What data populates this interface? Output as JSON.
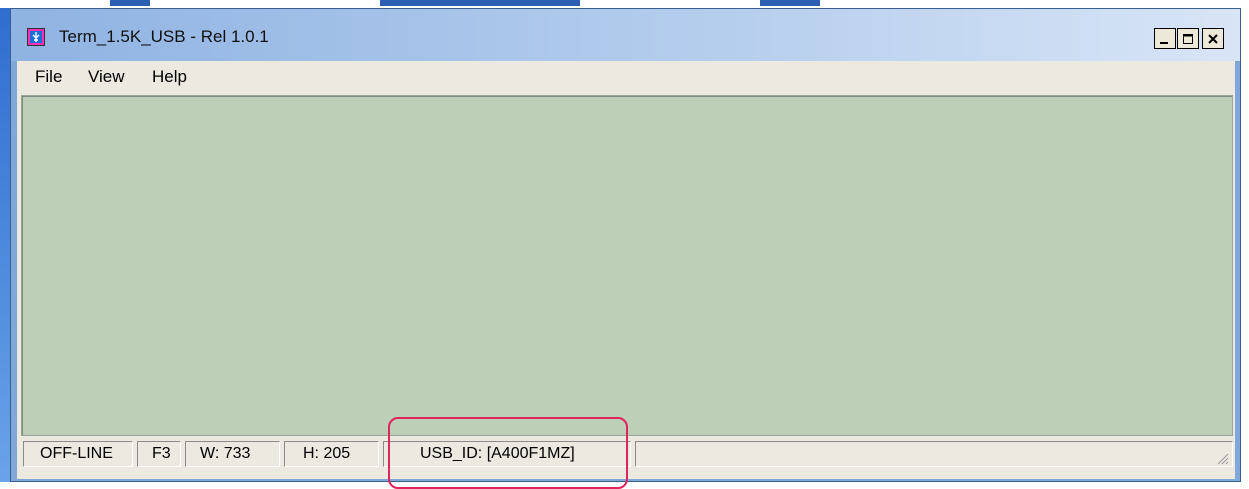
{
  "window": {
    "title": "Term_1.5K_USB - Rel 1.0.1",
    "icon": "usb-terminal-app-icon",
    "controls": [
      "minimize-icon",
      "maximize-icon",
      "close-icon"
    ]
  },
  "menubar": {
    "items": [
      {
        "label": "File"
      },
      {
        "label": "View"
      },
      {
        "label": "Help"
      }
    ]
  },
  "terminal": {
    "background_color": "#bccfb7"
  },
  "statusbar": {
    "connection": "OFF-LINE",
    "function_key": "F3",
    "width": "W:  733",
    "height": "H:  205",
    "usb_id": "USB_ID: [A400F1MZ]",
    "message": ""
  },
  "annotation": {
    "color": "#e0245e",
    "target": "usb_id"
  }
}
